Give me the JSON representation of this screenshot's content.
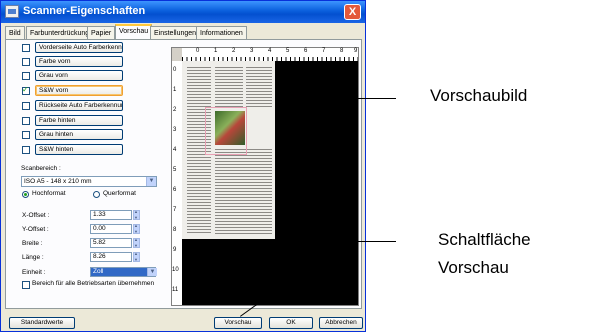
{
  "window": {
    "title": "Scanner-Eigenschaften",
    "close_glyph": "X"
  },
  "tabs": [
    "Bild",
    "Farbunterdrückung",
    "Papier",
    "Vorschau",
    "Einstellungen",
    "Informationen"
  ],
  "active_tab": "Vorschau",
  "image_options": [
    {
      "label": "Vorderseite Auto Farberkennung",
      "checked": false
    },
    {
      "label": "Farbe vorn",
      "checked": false
    },
    {
      "label": "Grau vorn",
      "checked": false
    },
    {
      "label": "S&W vorn",
      "checked": true,
      "selected": true
    },
    {
      "label": "Rückseite Auto Farberkennung",
      "checked": false
    },
    {
      "label": "Farbe hinten",
      "checked": false
    },
    {
      "label": "Grau hinten",
      "checked": false
    },
    {
      "label": "S&W hinten",
      "checked": false
    }
  ],
  "scan_area": {
    "label": "Scanbereich :",
    "selected": "ISO A5 - 148 x 210 mm",
    "orientation": {
      "portrait": "Hochformat",
      "landscape": "Querformat",
      "selected": "Hochformat"
    }
  },
  "fields": [
    {
      "label": "X-Offset :",
      "value": "1.33"
    },
    {
      "label": "Y-Offset :",
      "value": "0.00"
    },
    {
      "label": "Breite :",
      "value": "5.82"
    },
    {
      "label": "Länge :",
      "value": "8.26"
    }
  ],
  "unit": {
    "label": "Einheit :",
    "value": "Zoll"
  },
  "apply_all": {
    "label": "Bereich für alle Betriebsarten übernehmen",
    "checked": false
  },
  "buttons": {
    "defaults": "Standardwerte",
    "preview": "Vorschau",
    "ok": "OK",
    "cancel": "Abbrechen"
  },
  "ruler": {
    "horizontal": [
      "0",
      "1",
      "2",
      "3",
      "4",
      "5",
      "6",
      "7",
      "8",
      "9"
    ],
    "vertical": [
      "0",
      "1",
      "2",
      "3",
      "4",
      "5",
      "6",
      "7",
      "8",
      "9",
      "10",
      "11"
    ]
  },
  "callouts": {
    "preview_image": "Vorschaubild",
    "preview_button_line1": "Schaltfläche",
    "preview_button_line2": "Vorschau"
  },
  "colors": {
    "title_bar": "#0a5fdc",
    "selection_border": "#f0a030",
    "unit_select_bg": "#3169c6",
    "crop_frame": "#e8a0b4"
  }
}
